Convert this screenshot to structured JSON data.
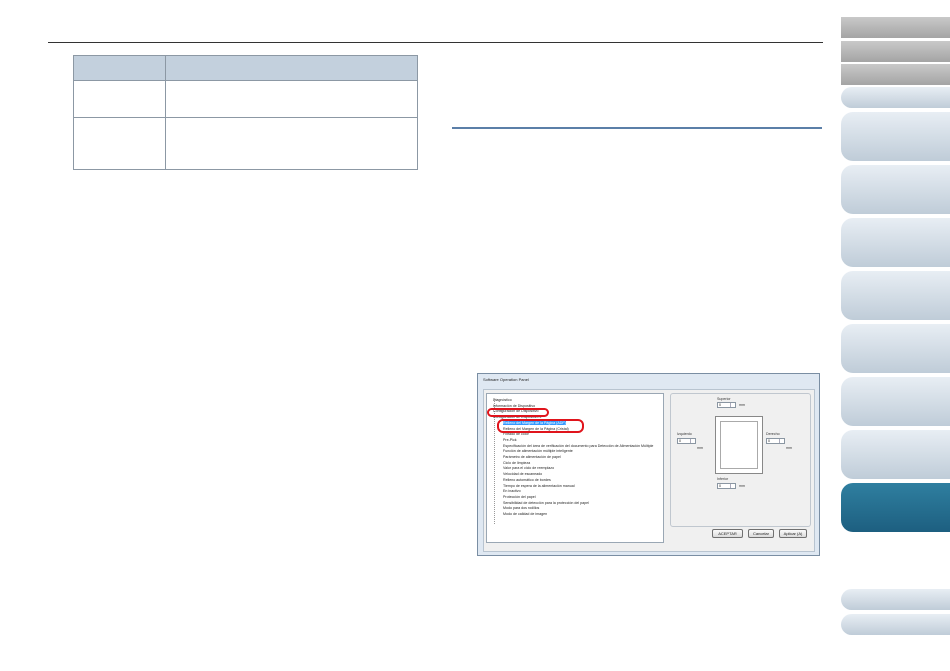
{
  "window": {
    "title": "Software Operation Panel",
    "tree": [
      {
        "label": "Diagnóstico",
        "level": 0
      },
      {
        "label": "Información de Dispositivo",
        "level": 0
      },
      {
        "label": "Configuración de Dispositivo",
        "level": 0
      },
      {
        "label": "Configuración de Dispositivo 2",
        "level": 0
      },
      {
        "label": "Relleno del Margen de la Página (ADF)",
        "level": 1,
        "selected": true
      },
      {
        "label": "Relleno del Margen de la Página (Cristal)",
        "level": 1
      },
      {
        "label": "Filtrado de color",
        "level": 1
      },
      {
        "label": "Pre-Pick",
        "level": 1
      },
      {
        "label": "Especificación del área de verificación del documento para Detección de Alimentación Múltiple",
        "level": 1
      },
      {
        "label": "Función de alimentación múltiple inteligente",
        "level": 1
      },
      {
        "label": "Parámetro de alimentación de papel",
        "level": 1
      },
      {
        "label": "Ciclo de limpieza",
        "level": 1
      },
      {
        "label": "Valor para el ciclo de reemplazo",
        "level": 1
      },
      {
        "label": "Velocidad de escaneado",
        "level": 1
      },
      {
        "label": "Relleno automático de bordes",
        "level": 1
      },
      {
        "label": "Tiempo de espera de la alimentación manual",
        "level": 1
      },
      {
        "label": "En inactivo",
        "level": 1
      },
      {
        "label": "Protección del papel",
        "level": 1
      },
      {
        "label": "Sensibilidad de detección para la protección del papel",
        "level": 1
      },
      {
        "label": "Modo para dos rodillos",
        "level": 1
      },
      {
        "label": "Modo de calidad de imagen",
        "level": 1
      }
    ],
    "margins": {
      "top_label": "Superior",
      "left_label": "Izquierdo",
      "right_label": "Derecho",
      "bottom_label": "Inferior",
      "top_value": "0",
      "left_value": "0",
      "right_value": "0",
      "bottom_value": "0",
      "unit": "mm"
    },
    "buttons": {
      "ok": "ACEPTAR",
      "cancel": "Cancelar",
      "apply": "Aplicar (A)"
    }
  }
}
